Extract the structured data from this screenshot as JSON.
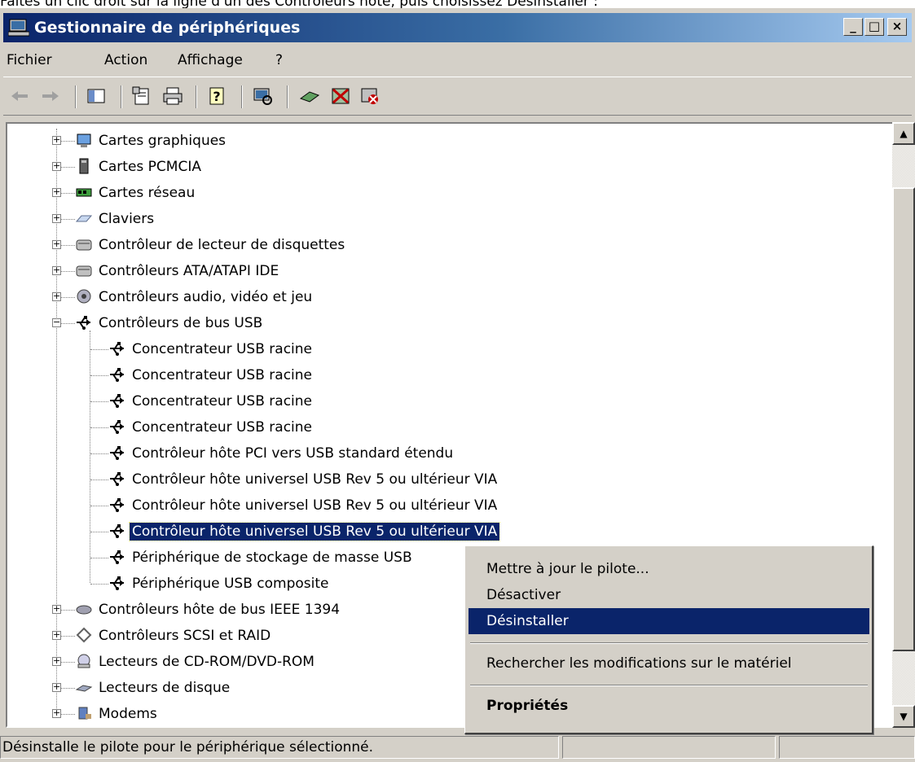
{
  "caption": "Faites un clic droit sur la ligne d'un des Contrôleurs hôte, puis choisissez Désinstaller :",
  "window": {
    "title": "Gestionnaire de périphériques",
    "buttons": {
      "minimize": "_",
      "maximize": "□",
      "close": "×"
    }
  },
  "menu": [
    "Fichier",
    "Action",
    "Affichage",
    "?"
  ],
  "toolbar_icons": [
    "back-arrow-icon",
    "forward-arrow-icon",
    "show-hide-console-tree-icon",
    "properties-icon",
    "print-icon",
    "help-icon",
    "scan-hardware-icon",
    "update-driver-icon",
    "disable-device-icon",
    "uninstall-device-icon"
  ],
  "tree": [
    {
      "label": "Cartes graphiques",
      "icon": "display-adapter-icon",
      "level": 0,
      "expander": "+"
    },
    {
      "label": "Cartes PCMCIA",
      "icon": "pcmcia-icon",
      "level": 0,
      "expander": "+"
    },
    {
      "label": "Cartes réseau",
      "icon": "network-adapter-icon",
      "level": 0,
      "expander": "+"
    },
    {
      "label": "Claviers",
      "icon": "keyboard-icon",
      "level": 0,
      "expander": "+"
    },
    {
      "label": "Contrôleur de lecteur de disquettes",
      "icon": "floppy-controller-icon",
      "level": 0,
      "expander": "+"
    },
    {
      "label": "Contrôleurs ATA/ATAPI IDE",
      "icon": "ide-controller-icon",
      "level": 0,
      "expander": "+"
    },
    {
      "label": "Contrôleurs audio, vidéo et jeu",
      "icon": "audio-icon",
      "level": 0,
      "expander": "+"
    },
    {
      "label": "Contrôleurs de bus USB",
      "icon": "usb-icon",
      "level": 0,
      "expander": "−"
    },
    {
      "label": "Concentrateur USB racine",
      "icon": "usb-icon",
      "level": 1
    },
    {
      "label": "Concentrateur USB racine",
      "icon": "usb-icon",
      "level": 1
    },
    {
      "label": "Concentrateur USB racine",
      "icon": "usb-icon",
      "level": 1
    },
    {
      "label": "Concentrateur USB racine",
      "icon": "usb-icon",
      "level": 1
    },
    {
      "label": "Contrôleur hôte PCI vers USB standard étendu",
      "icon": "usb-icon",
      "level": 1
    },
    {
      "label": "Contrôleur hôte universel USB Rev 5 ou  ultérieur VIA",
      "icon": "usb-icon",
      "level": 1
    },
    {
      "label": "Contrôleur hôte universel USB Rev 5 ou  ultérieur VIA",
      "icon": "usb-icon",
      "level": 1
    },
    {
      "label": "Contrôleur hôte universel USB Rev 5 ou  ultérieur VIA",
      "icon": "usb-icon",
      "level": 1,
      "selected": true
    },
    {
      "label": "Périphérique de stockage de masse USB",
      "icon": "usb-icon",
      "level": 1
    },
    {
      "label": "Périphérique USB composite",
      "icon": "usb-icon",
      "level": 1
    },
    {
      "label": "Contrôleurs hôte de bus IEEE 1394",
      "icon": "ieee1394-icon",
      "level": 0,
      "expander": "+"
    },
    {
      "label": "Contrôleurs SCSI et RAID",
      "icon": "scsi-icon",
      "level": 0,
      "expander": "+"
    },
    {
      "label": "Lecteurs de CD-ROM/DVD-ROM",
      "icon": "cdrom-icon",
      "level": 0,
      "expander": "+"
    },
    {
      "label": "Lecteurs de disque",
      "icon": "disk-drive-icon",
      "level": 0,
      "expander": "+"
    },
    {
      "label": "Modems",
      "icon": "modem-icon",
      "level": 0,
      "expander": "+"
    }
  ],
  "context_menu": [
    {
      "label": "Mettre à jour le pilote...",
      "name": "ctx-update-driver"
    },
    {
      "label": "Désactiver",
      "name": "ctx-disable"
    },
    {
      "label": "Désinstaller",
      "name": "ctx-uninstall",
      "highlighted": true
    },
    {
      "label": "Rechercher les modifications sur le matériel",
      "name": "ctx-scan-hardware"
    },
    {
      "label": "Propriétés",
      "name": "ctx-properties",
      "bold": true
    }
  ],
  "status": {
    "text": "Désinstalle le pilote pour le périphérique sélectionné."
  },
  "colors": {
    "selection": "#0a246a",
    "titlebar_start": "#0a246a",
    "titlebar_end": "#a6caf0",
    "chrome": "#d4d0c8"
  }
}
